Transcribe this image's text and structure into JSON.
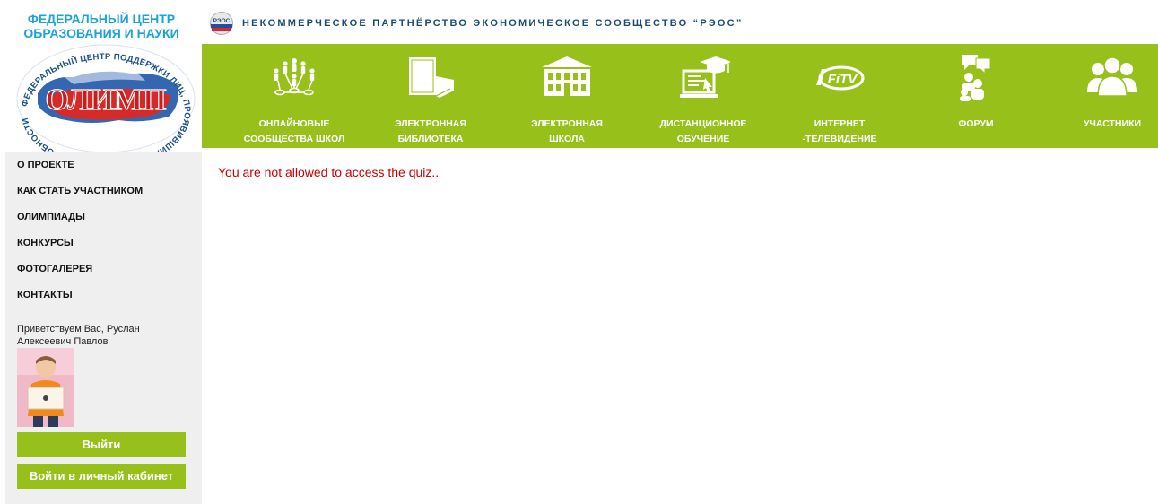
{
  "logo": {
    "title_line1": "ФЕДЕРАЛЬНЫЙ ЦЕНТР",
    "title_line2": "ОБРАЗОВАНИЯ И НАУКИ",
    "emblem_word": "ОЛИМП",
    "ring_text": "ФЕДЕРАЛЬНЫЙ ЦЕНТР ПОДДЕРЖКИ ЛИЦ, ПРОЯВИВШИХ ВЫДАЮЩИЕСЯ СПОСОБНОСТИ"
  },
  "header": {
    "badge": "РЭОС",
    "partnership": "НЕКОММЕРЧЕСКОЕ ПАРТНЁРСТВО ЭКОНОМИЧЕСКОЕ СООБЩЕСТВО “РЭОС”"
  },
  "colors": {
    "green": "#97c11a",
    "blue_title": "#1aa3d9",
    "error": "#cc0000"
  },
  "nav": [
    {
      "label": "ОНЛАЙНОВЫЕ\nСООБЩЕСТВА ШКОЛ",
      "icon": "network-people-icon"
    },
    {
      "label": "ЭЛЕКТРОННАЯ\nБИБЛИОТЕКА",
      "icon": "books-icon"
    },
    {
      "label": "ЭЛЕКТРОННАЯ\nШКОЛА",
      "icon": "school-building-icon"
    },
    {
      "label": "ДИСТАНЦИОННОЕ\nОБУЧЕНИЕ",
      "icon": "graduation-laptop-icon"
    },
    {
      "label": "ИНТЕРНЕТ\n-ТЕЛЕВИДЕНИЕ",
      "icon": "fitv-logo-icon"
    },
    {
      "label": "ФОРУМ",
      "icon": "forum-chat-icon"
    },
    {
      "label": "УЧАСТНИКИ",
      "icon": "participants-icon"
    }
  ],
  "nav_icon_text": {
    "fitv": "FiTV"
  },
  "sidebar": {
    "items": [
      {
        "label": "О ПРОЕКТЕ"
      },
      {
        "label": "КАК СТАТЬ УЧАСТНИКОМ"
      },
      {
        "label": "ОЛИМПИАДЫ"
      },
      {
        "label": "КОНКУРСЫ"
      },
      {
        "label": "ФОТОГАЛЕРЕЯ"
      },
      {
        "label": "КОНТАКТЫ"
      }
    ],
    "welcome": "Приветствуем Вас, Руслан Алексеевич Павлов",
    "logout_label": "Выйти",
    "cabinet_label": "Войти в личный кабинет"
  },
  "main": {
    "message": "You are not allowed to access the quiz.."
  }
}
